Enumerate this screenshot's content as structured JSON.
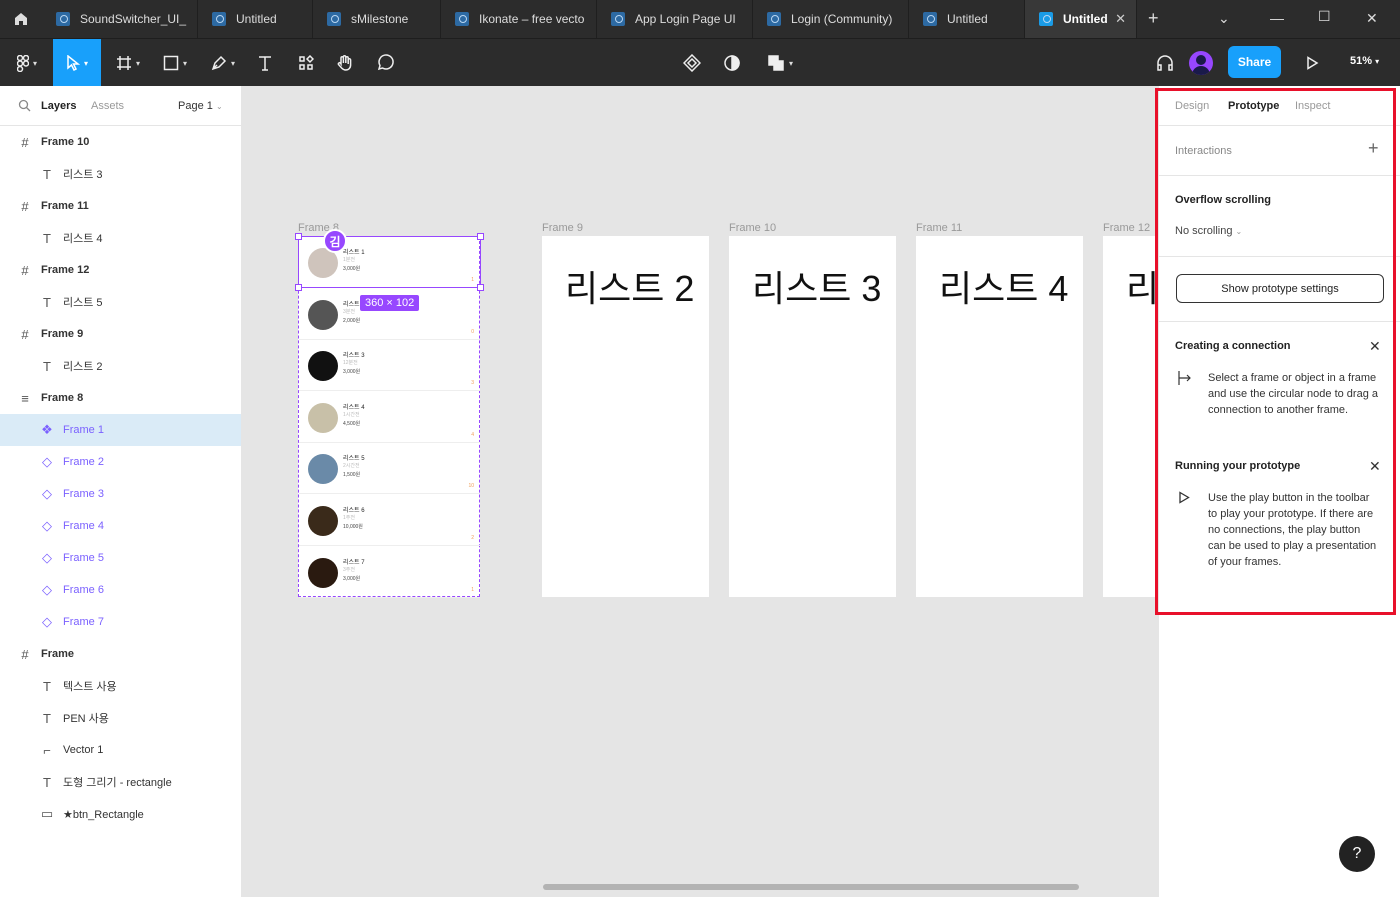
{
  "tabs": [
    {
      "label": "SoundSwitcher_UI_"
    },
    {
      "label": "Untitled"
    },
    {
      "label": "sMilestone"
    },
    {
      "label": "Ikonate – free vecto"
    },
    {
      "label": "App Login Page UI"
    },
    {
      "label": "Login (Community)"
    },
    {
      "label": "Untitled"
    },
    {
      "label": "Untitled"
    }
  ],
  "toolbar": {
    "share": "Share",
    "zoom": "51%"
  },
  "left_panel": {
    "tabs": {
      "layers": "Layers",
      "assets": "Assets"
    },
    "page": "Page 1",
    "layers": [
      {
        "label": "Frame 10",
        "icon": "#"
      },
      {
        "label": "리스트 3",
        "icon": "T"
      },
      {
        "label": "Frame 11",
        "icon": "#"
      },
      {
        "label": "리스트 4",
        "icon": "T"
      },
      {
        "label": "Frame 12",
        "icon": "#"
      },
      {
        "label": "리스트 5",
        "icon": "T"
      },
      {
        "label": "Frame 9",
        "icon": "#"
      },
      {
        "label": "리스트 2",
        "icon": "T"
      },
      {
        "label": "Frame 8",
        "icon": "≡"
      },
      {
        "label": "Frame 1",
        "icon": "❖"
      },
      {
        "label": "Frame 2",
        "icon": "◇"
      },
      {
        "label": "Frame 3",
        "icon": "◇"
      },
      {
        "label": "Frame 4",
        "icon": "◇"
      },
      {
        "label": "Frame 5",
        "icon": "◇"
      },
      {
        "label": "Frame 6",
        "icon": "◇"
      },
      {
        "label": "Frame 7",
        "icon": "◇"
      },
      {
        "label": "Frame",
        "icon": "#"
      },
      {
        "label": "텍스트 사용",
        "icon": "T"
      },
      {
        "label": "PEN 사용",
        "icon": "T"
      },
      {
        "label": "Vector 1",
        "icon": "⌐"
      },
      {
        "label": "도형 그리기 - rectangle",
        "icon": "T"
      },
      {
        "label": "★btn_Rectangle",
        "icon": "▭"
      }
    ]
  },
  "canvas": {
    "frame8_label": "Frame 8",
    "frames": [
      {
        "label": "Frame 9",
        "text": "리스트 2"
      },
      {
        "label": "Frame 10",
        "text": "리스트 3"
      },
      {
        "label": "Frame 11",
        "text": "리스트 4"
      },
      {
        "label": "Frame 12",
        "text": "리"
      }
    ],
    "list_rows": [
      {
        "name": "리스트 1",
        "sub": "1분전",
        "price": "3,000원",
        "count": "1"
      },
      {
        "name": "리스트 2",
        "sub": "3분전",
        "price": "2,000원",
        "count": "0"
      },
      {
        "name": "리스트 3",
        "sub": "12분전",
        "price": "3,000원",
        "count": "3"
      },
      {
        "name": "리스트 4",
        "sub": "1시간전",
        "price": "4,500원",
        "count": "4"
      },
      {
        "name": "리스트 5",
        "sub": "2시간전",
        "price": "1,500원",
        "count": "10"
      },
      {
        "name": "리스트 6",
        "sub": "1주전",
        "price": "10,000원",
        "count": "2"
      },
      {
        "name": "리스트 7",
        "sub": "3주전",
        "price": "3,000원",
        "count": "1"
      }
    ],
    "selection_size": "360 × 102",
    "collaborator_initial": "김"
  },
  "right_panel": {
    "tabs": {
      "design": "Design",
      "prototype": "Prototype",
      "inspect": "Inspect"
    },
    "interactions": "Interactions",
    "overflow_title": "Overflow scrolling",
    "overflow_value": "No scrolling",
    "settings_button": "Show prototype settings",
    "creating_title": "Creating a connection",
    "creating_text": "Select a frame or object in a frame and use the circular node to drag a connection to another frame.",
    "running_title": "Running your prototype",
    "running_text": "Use the play button in the toolbar to play your prototype. If there are no connections, the play button can be used to play a presentation of your frames."
  },
  "help": "?"
}
